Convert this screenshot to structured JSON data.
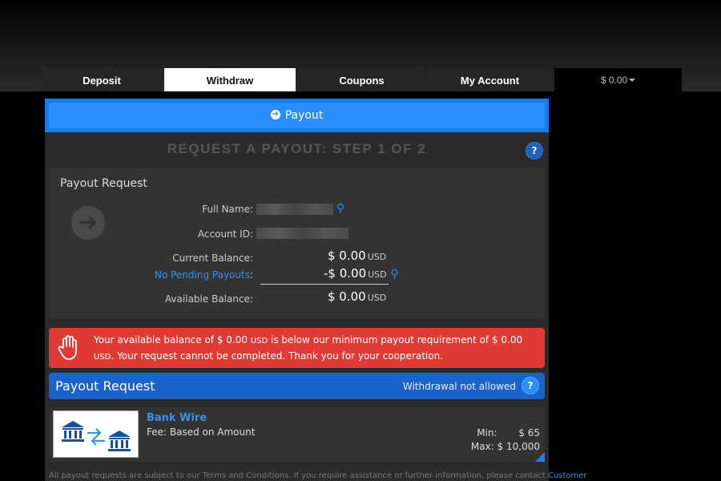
{
  "tabs": [
    {
      "label": "Deposit",
      "active": false
    },
    {
      "label": "Withdraw",
      "active": true
    },
    {
      "label": "Coupons",
      "active": false
    },
    {
      "label": "My Account",
      "active": false
    }
  ],
  "balance_menu": {
    "label": "$ 0.00"
  },
  "payout_button": {
    "label": "Payout",
    "icon": "circle-arrow-right-icon"
  },
  "step_title": "REQUEST A PAYOUT: STEP 1 OF 2",
  "help_icon": "?",
  "payout_card": {
    "title": "Payout Request",
    "full_name_label": "Full Name:",
    "account_id_label": "Account ID:",
    "current_balance_label": "Current Balance:",
    "current_balance_value": "$ 0.00",
    "pending_label": "No Pending Payouts",
    "pending_colon": ":",
    "pending_value": "-$ 0.00",
    "available_label": "Available Balance:",
    "available_value": "$ 0.00",
    "currency": "USD"
  },
  "alert": {
    "text_1": "Your available balance of $ 0.00 ",
    "usd_1": "USD",
    "text_2": " is below our minimum payout requirement of $ 0.00",
    "usd_2": "USD",
    "text_3": ". Your request cannot be completed. Thank you for your cooperation."
  },
  "payout_request": {
    "title": "Payout Request",
    "note": "Withdrawal not allowed"
  },
  "method": {
    "name": "Bank Wire",
    "fee": "Fee: Based on Amount",
    "min_label": "Min:",
    "min_value": "$ 65",
    "max_label": "Max:",
    "max_value": "$ 10,000"
  },
  "footer": {
    "text": "All payout requests are subject to our Terms and Conditions. If you require assistance or further information, please contact ",
    "link": "Customer"
  },
  "colors": {
    "accent": "#1a7ae6",
    "alert": "#e03a34",
    "link": "#3a8fe6"
  }
}
